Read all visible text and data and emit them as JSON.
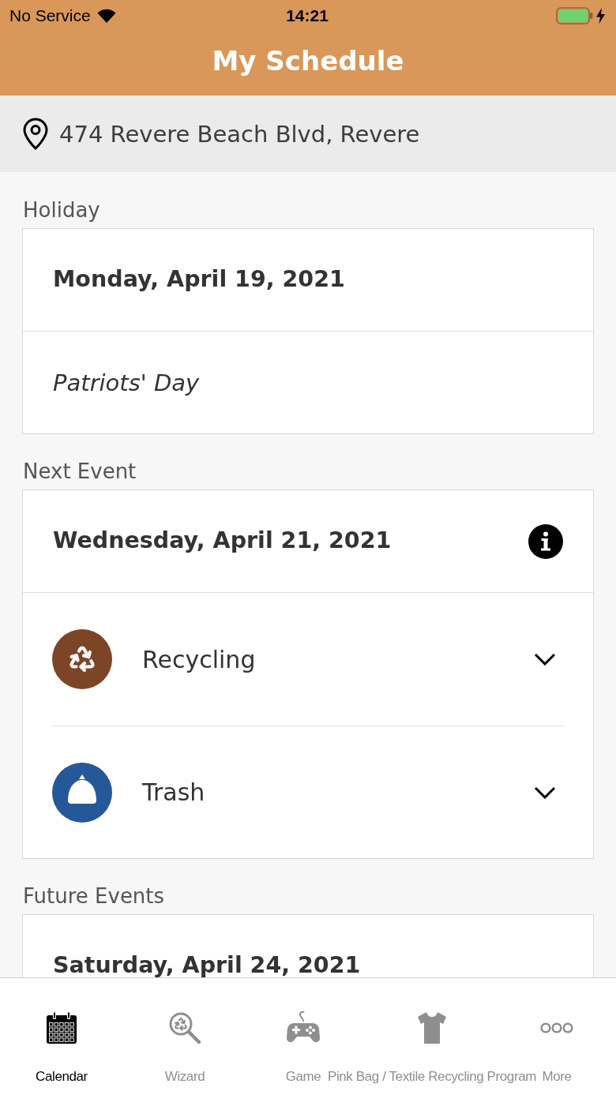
{
  "status_bar": {
    "carrier": "No Service",
    "time": "14:21"
  },
  "nav_bar": {
    "title": "My Schedule"
  },
  "location": {
    "address": "474 Revere Beach Blvd, Revere"
  },
  "sections": [
    {
      "title": "Holiday",
      "date": "Monday, April 19, 2021",
      "note": "Patriots' Day"
    },
    {
      "title": "Next Event",
      "date": "Wednesday, April 21, 2021",
      "info": true,
      "events": [
        {
          "name": "Recycling",
          "color": "#7c4526",
          "expanded": false
        },
        {
          "name": "Trash",
          "color": "#245898",
          "expanded": false
        }
      ]
    },
    {
      "title": "Future Events",
      "date": "Saturday, April 24, 2021"
    }
  ],
  "tabs": [
    {
      "label": "Calendar",
      "selected": true
    },
    {
      "label": "Wizard",
      "selected": false
    },
    {
      "label": "Game",
      "selected": false
    },
    {
      "label": "Pink Bag / Textile Recycling Program",
      "selected": false
    },
    {
      "label": "More",
      "selected": false
    }
  ]
}
